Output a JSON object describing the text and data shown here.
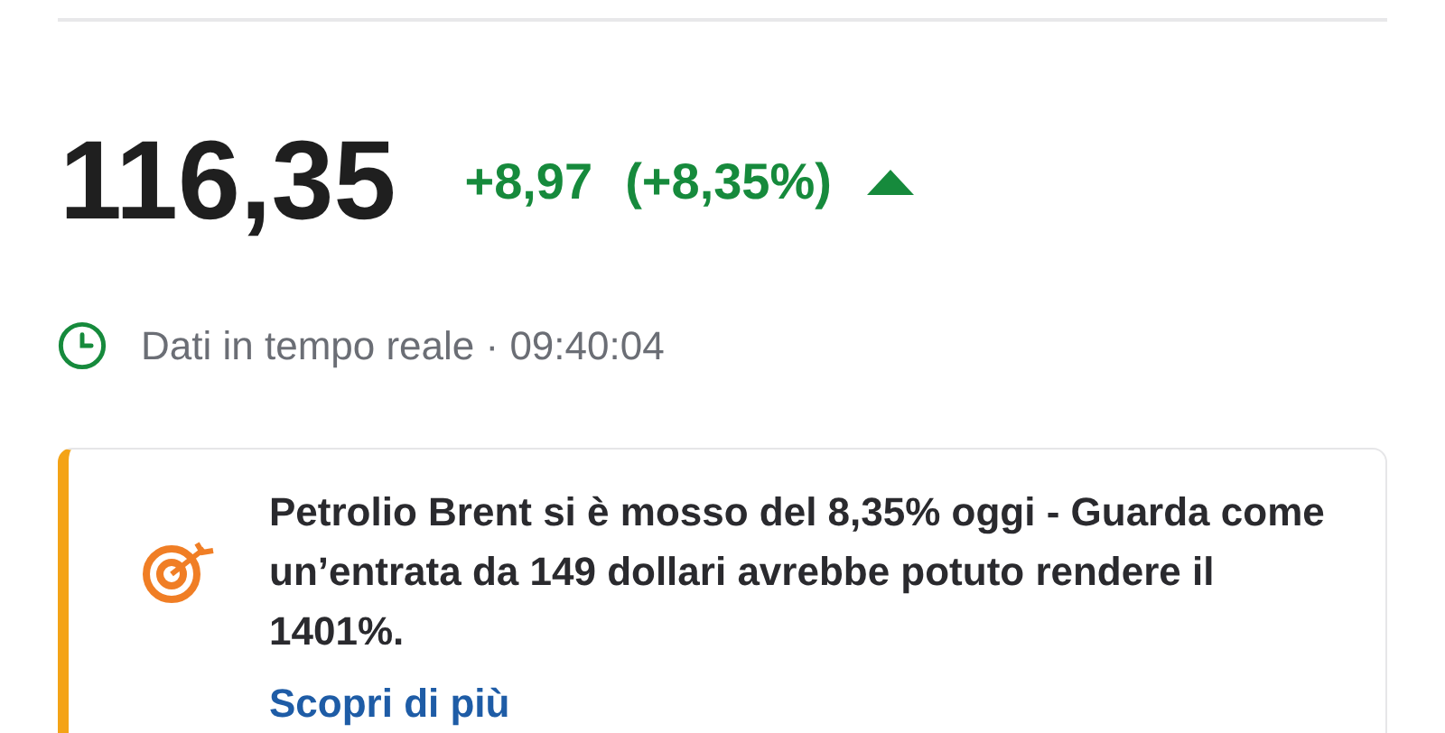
{
  "quote": {
    "price": "116,35",
    "change": "+8,97",
    "change_percent": "(+8,35%)",
    "rising": true
  },
  "status": {
    "text": "Dati in tempo reale · 09:40:04"
  },
  "promo": {
    "message": "Petrolio Brent si è mosso del 8,35% oggi - Guarda come un’entrata da 149 dollari avrebbe potuto rendere il 1401%.",
    "link": "Scopri di più"
  }
}
